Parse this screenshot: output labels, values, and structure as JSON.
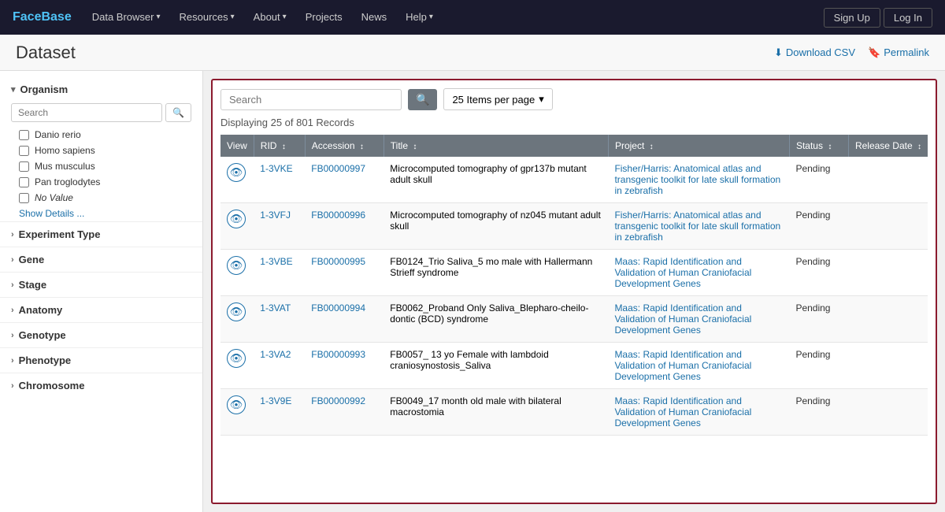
{
  "navbar": {
    "brand": "FaceBase",
    "items": [
      {
        "label": "Data Browser",
        "has_dropdown": true
      },
      {
        "label": "Resources",
        "has_dropdown": true
      },
      {
        "label": "About",
        "has_dropdown": true
      },
      {
        "label": "Projects",
        "has_dropdown": false
      },
      {
        "label": "News",
        "has_dropdown": false
      },
      {
        "label": "Help",
        "has_dropdown": true
      }
    ],
    "sign_up": "Sign Up",
    "log_in": "Log In"
  },
  "page": {
    "title": "Dataset",
    "download_csv": "Download CSV",
    "permalink": "Permalink"
  },
  "sidebar": {
    "organism_label": "Organism",
    "search_placeholder": "Search",
    "items": [
      {
        "label": "Danio rerio",
        "checked": false
      },
      {
        "label": "Homo sapiens",
        "checked": false
      },
      {
        "label": "Mus musculus",
        "checked": false
      },
      {
        "label": "Pan troglodytes",
        "checked": false
      },
      {
        "label": "No Value",
        "checked": false,
        "italic": true
      }
    ],
    "show_details": "Show Details ...",
    "sections": [
      {
        "label": "Experiment Type",
        "expanded": false
      },
      {
        "label": "Gene",
        "expanded": false
      },
      {
        "label": "Stage",
        "expanded": false
      },
      {
        "label": "Anatomy",
        "expanded": false
      },
      {
        "label": "Genotype",
        "expanded": false
      },
      {
        "label": "Phenotype",
        "expanded": false
      },
      {
        "label": "Chromosome",
        "expanded": false
      }
    ]
  },
  "toolbar": {
    "search_placeholder": "Search",
    "per_page": "25 Items per page",
    "records_info": "Displaying 25 of 801 Records"
  },
  "table": {
    "columns": [
      {
        "label": "View",
        "sortable": false
      },
      {
        "label": "RID",
        "sortable": true
      },
      {
        "label": "Accession",
        "sortable": true
      },
      {
        "label": "Title",
        "sortable": true
      },
      {
        "label": "Project",
        "sortable": true
      },
      {
        "label": "Status",
        "sortable": true
      },
      {
        "label": "Release Date",
        "sortable": true
      }
    ],
    "rows": [
      {
        "rid": "1-3VKE",
        "accession": "FB00000997",
        "title": "Microcomputed tomography of gpr137b mutant adult skull",
        "project": "Fisher/Harris: Anatomical atlas and transgenic toolkit for late skull formation in zebrafish",
        "status": "Pending",
        "release_date": ""
      },
      {
        "rid": "1-3VFJ",
        "accession": "FB00000996",
        "title": "Microcomputed tomography of nz045 mutant adult skull",
        "project": "Fisher/Harris: Anatomical atlas and transgenic toolkit for late skull formation in zebrafish",
        "status": "Pending",
        "release_date": ""
      },
      {
        "rid": "1-3VBE",
        "accession": "FB00000995",
        "title": "FB0124_Trio Saliva_5 mo male with Hallermann Strieff syndrome",
        "project": "Maas: Rapid Identification and Validation of Human Craniofacial Development Genes",
        "status": "Pending",
        "release_date": ""
      },
      {
        "rid": "1-3VAT",
        "accession": "FB00000994",
        "title": "FB0062_Proband Only Saliva_Blepharo-cheilo-dontic (BCD) syndrome",
        "project": "Maas: Rapid Identification and Validation of Human Craniofacial Development Genes",
        "status": "Pending",
        "release_date": ""
      },
      {
        "rid": "1-3VA2",
        "accession": "FB00000993",
        "title": "FB0057_ 13 yo Female with lambdoid craniosynostosis_Saliva",
        "project": "Maas: Rapid Identification and Validation of Human Craniofacial Development Genes",
        "status": "Pending",
        "release_date": ""
      },
      {
        "rid": "1-3V9E",
        "accession": "FB00000992",
        "title": "FB0049_17 month old male with bilateral macrostomia",
        "project": "Maas: Rapid Identification and Validation of Human Craniofacial Development Genes",
        "status": "Pending",
        "release_date": ""
      }
    ]
  },
  "icons": {
    "download": "⬇",
    "bookmark": "🔖",
    "search": "🔍",
    "eye": "👁",
    "chevron_down": "▾",
    "chevron_right": "›",
    "chevron_left": "‹",
    "sort": "↕"
  }
}
